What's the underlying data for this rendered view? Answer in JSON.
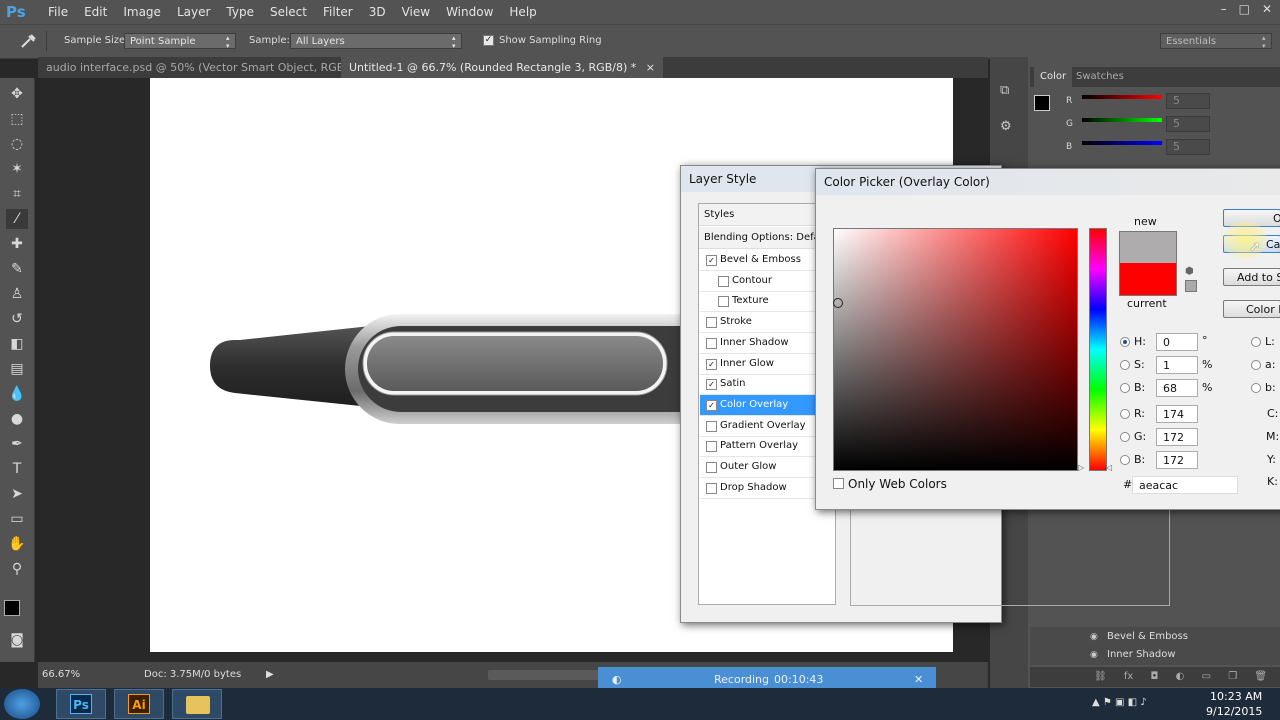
{
  "app": {
    "logo": "Ps"
  },
  "menu": [
    "File",
    "Edit",
    "Image",
    "Layer",
    "Type",
    "Select",
    "Filter",
    "3D",
    "View",
    "Window",
    "Help"
  ],
  "window_buttons": [
    "–",
    "□",
    "✕"
  ],
  "options": {
    "sample_size_label": "Sample Size:",
    "sample_size_value": "Point Sample",
    "sample_label": "Sample:",
    "sample_value": "All Layers",
    "sampling_ring_label": "Show Sampling Ring",
    "workspace": "Essentials"
  },
  "tabs": [
    {
      "label": "audio interface.psd @ 50% (Vector Smart Object, RGB/8)"
    },
    {
      "label": "Untitled-1 @ 66.7% (Rounded Rectangle 3, RGB/8) *",
      "close": "×"
    }
  ],
  "status": {
    "zoom": "66.67%",
    "doc": "Doc: 3.75M/0 bytes"
  },
  "color_panel": {
    "tabs": [
      "Color",
      "Swatches"
    ],
    "sliders": [
      {
        "label": "R",
        "value": "5"
      },
      {
        "label": "G",
        "value": "5"
      },
      {
        "label": "B",
        "value": "5"
      }
    ]
  },
  "layers_effects": [
    "Bevel & Emboss",
    "Inner Shadow"
  ],
  "layer_style": {
    "title": "Layer Style",
    "styles_header": "Styles",
    "blending": "Blending Options: Default",
    "items": [
      {
        "label": "Bevel & Emboss",
        "checked": true,
        "sub": false,
        "selected": false
      },
      {
        "label": "Contour",
        "checked": false,
        "sub": true,
        "selected": false
      },
      {
        "label": "Texture",
        "checked": false,
        "sub": true,
        "selected": false
      },
      {
        "label": "Stroke",
        "checked": false,
        "sub": false,
        "selected": false
      },
      {
        "label": "Inner Shadow",
        "checked": false,
        "sub": false,
        "selected": false
      },
      {
        "label": "Inner Glow",
        "checked": true,
        "sub": false,
        "selected": false
      },
      {
        "label": "Satin",
        "checked": true,
        "sub": false,
        "selected": false
      },
      {
        "label": "Color Overlay",
        "checked": true,
        "sub": false,
        "selected": true
      },
      {
        "label": "Gradient Overlay",
        "checked": false,
        "sub": false,
        "selected": false
      },
      {
        "label": "Pattern Overlay",
        "checked": false,
        "sub": false,
        "selected": false
      },
      {
        "label": "Outer Glow",
        "checked": false,
        "sub": false,
        "selected": false
      },
      {
        "label": "Drop Shadow",
        "checked": false,
        "sub": false,
        "selected": false
      }
    ]
  },
  "picker": {
    "title": "Color Picker (Overlay Color)",
    "new_label": "new",
    "current_label": "current",
    "new_color": "#aeacac",
    "current_color": "#ff0000",
    "only_web": "Only Web Colors",
    "hsb": [
      {
        "label": "H:",
        "value": "0",
        "unit": "°",
        "on": true
      },
      {
        "label": "S:",
        "value": "1",
        "unit": "%",
        "on": false
      },
      {
        "label": "B:",
        "value": "68",
        "unit": "%",
        "on": false
      }
    ],
    "rgb": [
      {
        "label": "R:",
        "value": "174"
      },
      {
        "label": "G:",
        "value": "172"
      },
      {
        "label": "B:",
        "value": "172"
      }
    ],
    "lab": [
      {
        "label": "L:"
      },
      {
        "label": "a:"
      },
      {
        "label": "b:"
      }
    ],
    "cmyk": [
      {
        "label": "C:"
      },
      {
        "label": "M:"
      },
      {
        "label": "Y:"
      },
      {
        "label": "K:"
      }
    ],
    "hex_label": "#",
    "hex": "aeacac",
    "buttons": [
      "O",
      "Car",
      "Add to S",
      "Color L"
    ]
  },
  "recording": {
    "label": "Recording",
    "time": "00:10:43"
  },
  "taskbar": {
    "apps": [
      "Ps",
      "Ai"
    ],
    "time": "10:23 AM",
    "date": "9/12/2015"
  }
}
